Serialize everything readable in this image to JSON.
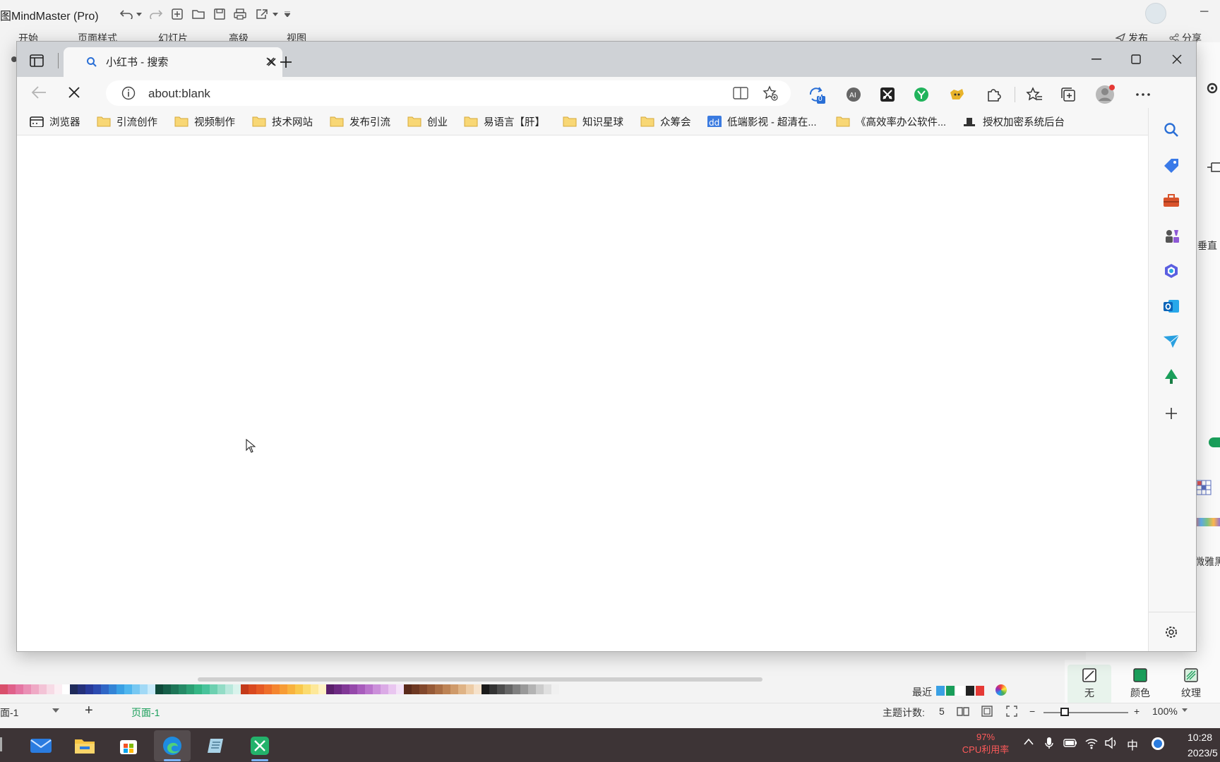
{
  "mindmaster": {
    "title": "图MindMaster (Pro)",
    "menu": [
      "开始",
      "页面样式",
      "幻灯片",
      "高级",
      "视图"
    ],
    "publish": "发布",
    "share": "分享",
    "right_panel": {
      "label_vertical": "垂直",
      "label_font": "微雅黑"
    },
    "format_buttons": [
      "无",
      "颜色",
      "纹理"
    ],
    "recent_label": "最近",
    "status": {
      "page_dropdown": "面-1",
      "add_page": "+",
      "page_tab": "页面-1",
      "topic_count_label": "主题计数:",
      "topic_count": "5",
      "zoom": "100%"
    },
    "palette": [
      "#d94f6b",
      "#e0618a",
      "#e576a3",
      "#ea8fb5",
      "#efa9c5",
      "#f3c3d6",
      "#f7dbe6",
      "#fbeef3",
      "#fff",
      "#1f2a5a",
      "#24307a",
      "#283a9a",
      "#2c4bb0",
      "#2f66c6",
      "#3384d6",
      "#3aa0e4",
      "#4fb6ee",
      "#77c8f2",
      "#a1d9f6",
      "#c9eafa",
      "#0f4a3a",
      "#165f49",
      "#1d7557",
      "#258a66",
      "#2ca074",
      "#35b685",
      "#48c39b",
      "#6dd0b0",
      "#93dcc6",
      "#b9e8dc",
      "#d9f3ec",
      "#c43a1a",
      "#d9491f",
      "#e55a25",
      "#ee6e2a",
      "#f4852f",
      "#f79c35",
      "#f8b23e",
      "#f9c84d",
      "#fbdb6f",
      "#fde899",
      "#fef2c4",
      "#5a1f6b",
      "#6d2a82",
      "#813796",
      "#9548aa",
      "#a85cbc",
      "#ba74cc",
      "#cb8fda",
      "#dbaae6",
      "#e9c6f0",
      "#f4e2f8",
      "#5a2a1a",
      "#6e3822",
      "#82482c",
      "#965a37",
      "#aa6e45",
      "#bd8355",
      "#cf9a6a",
      "#dfb385",
      "#edcca6",
      "#f6e2cb",
      "#1a1a1a",
      "#333",
      "#4d4d4d",
      "#666",
      "#808080",
      "#999",
      "#b3b3b3",
      "#ccc",
      "#e0e0e0",
      "#f0f0f0"
    ]
  },
  "browser": {
    "tab_title": "小红书 - 搜索",
    "address": "about:blank",
    "badge_count": "0",
    "favorites": [
      "浏览器",
      "引流创作",
      "视频制作",
      "技术网站",
      "发布引流",
      "创业",
      "易语言【肝】",
      "知识星球",
      "众筹会",
      "低端影视 - 超清在...",
      "《高效率办公软件...",
      "授权加密系统后台"
    ]
  },
  "taskbar": {
    "cpu_percent": "97%",
    "cpu_label": "CPU利用率",
    "ime": "中",
    "time": "10:28",
    "date": "2023/5"
  },
  "colors": {
    "accent_green": "#1a9e5a",
    "taskbar_bg": "#3d3436",
    "cpu_red": "#ff5a5a"
  }
}
